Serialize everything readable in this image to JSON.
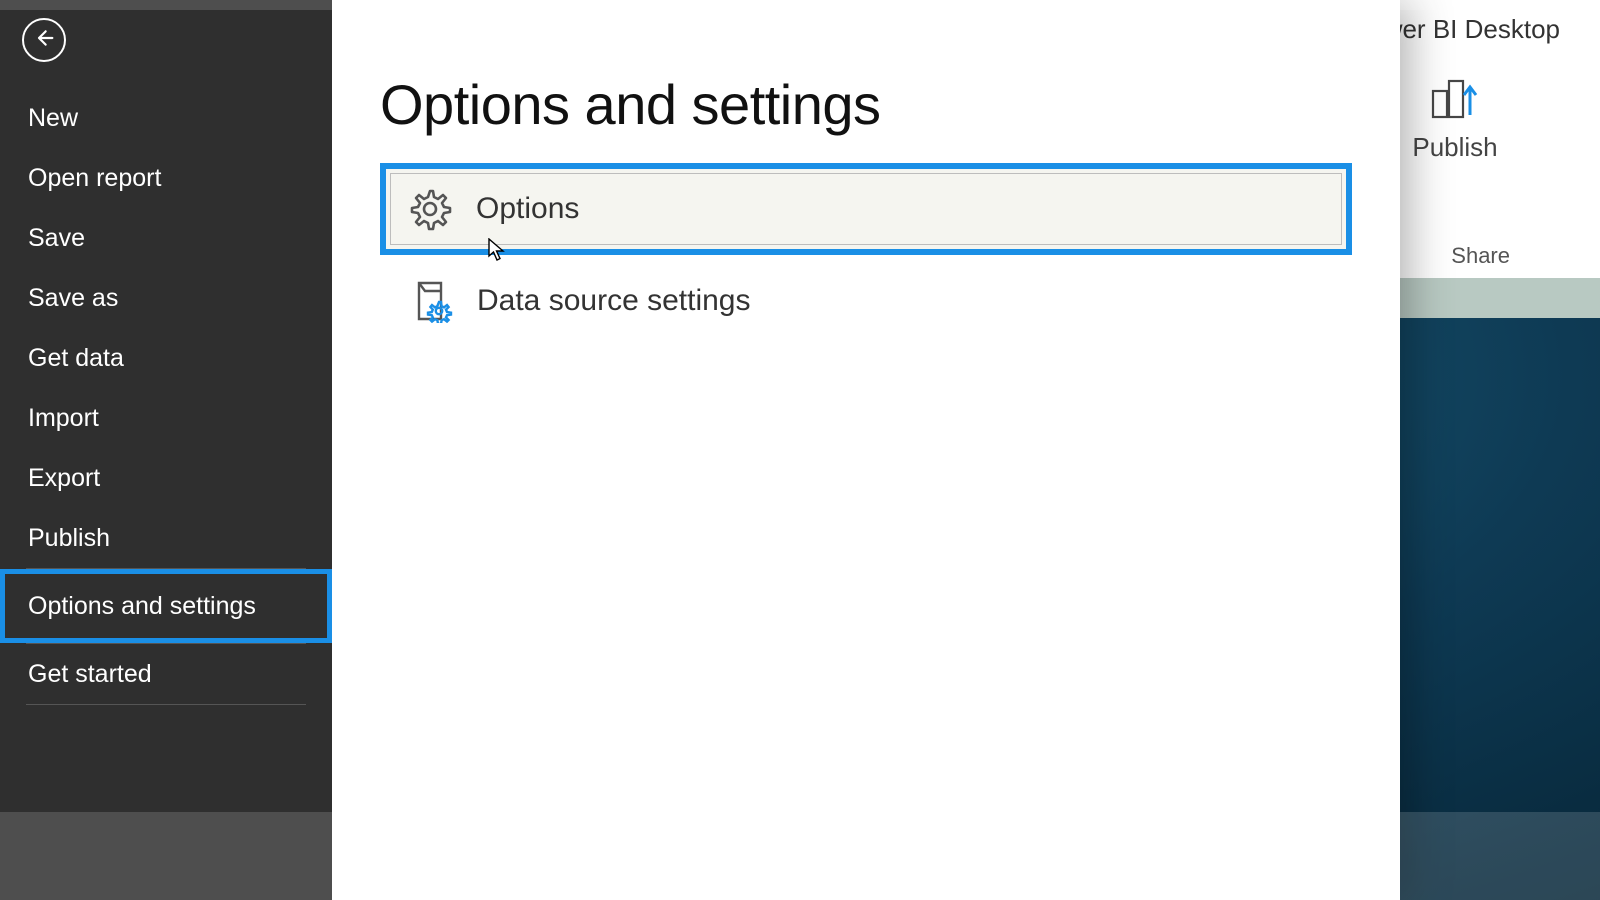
{
  "app": {
    "title_suffix": "- Power BI Desktop",
    "ribbon": {
      "publish_label": "Publish",
      "share_group_label": "Share"
    }
  },
  "file_menu": {
    "items": [
      {
        "id": "new",
        "label": "New"
      },
      {
        "id": "open-report",
        "label": "Open report"
      },
      {
        "id": "save",
        "label": "Save"
      },
      {
        "id": "save-as",
        "label": "Save as"
      },
      {
        "id": "get-data",
        "label": "Get data"
      },
      {
        "id": "import",
        "label": "Import"
      },
      {
        "id": "export",
        "label": "Export"
      },
      {
        "id": "publish",
        "label": "Publish"
      },
      {
        "id": "options-settings",
        "label": "Options and settings"
      },
      {
        "id": "get-started",
        "label": "Get started"
      }
    ],
    "selected_index": 8
  },
  "page": {
    "title": "Options and settings",
    "option_rows": [
      {
        "id": "options",
        "label": "Options",
        "icon": "gear",
        "selected": true
      },
      {
        "id": "data-source-settings",
        "label": "Data source settings",
        "icon": "data-source-gear",
        "selected": false
      }
    ]
  },
  "highlight_color": "#1a8fe6"
}
